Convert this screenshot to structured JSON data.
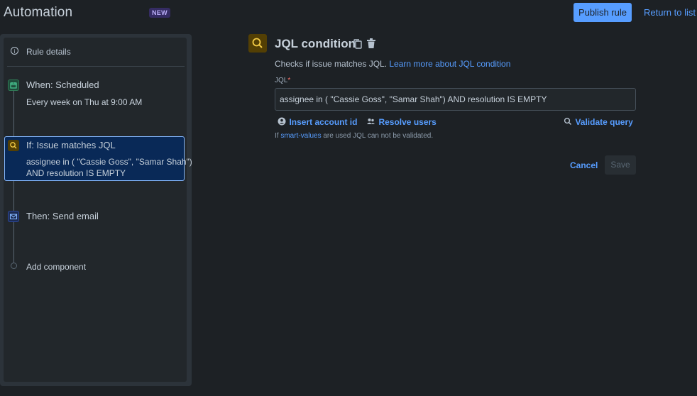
{
  "header": {
    "title": "Automation",
    "badge": "NEW",
    "publish_label": "Publish rule",
    "return_label": "Return to list"
  },
  "sidebar": {
    "rule_details": "Rule details",
    "steps": [
      {
        "title": "When: Scheduled",
        "sub1": "Every week on Thu at 9:00 AM",
        "sub2": ""
      },
      {
        "title": "If: Issue matches JQL",
        "sub1": "assignee in ( \"Cassie Goss\", \"Samar Shah\")",
        "sub2": "AND resolution IS EMPTY"
      },
      {
        "title": "Then: Send email",
        "sub1": "",
        "sub2": ""
      }
    ],
    "add_component": "Add component"
  },
  "panel": {
    "title": "JQL condition",
    "desc_prefix": "Checks if issue matches JQL.",
    "desc_link": "Learn more about JQL condition",
    "field_label": "JQL",
    "required_mark": "*",
    "jql_value": "assignee in ( \"Cassie Goss\", \"Samar Shah\") AND resolution IS EMPTY",
    "insert_account": "Insert account id",
    "resolve_users": "Resolve users",
    "validate_query": "Validate query",
    "note_prefix": "If",
    "note_link": "smart-values",
    "note_suffix": "are used JQL can not be validated.",
    "cancel_label": "Cancel",
    "save_label": "Save"
  },
  "colors": {
    "accent": "#579dff",
    "background": "#1d2125",
    "selected": "#092957"
  }
}
